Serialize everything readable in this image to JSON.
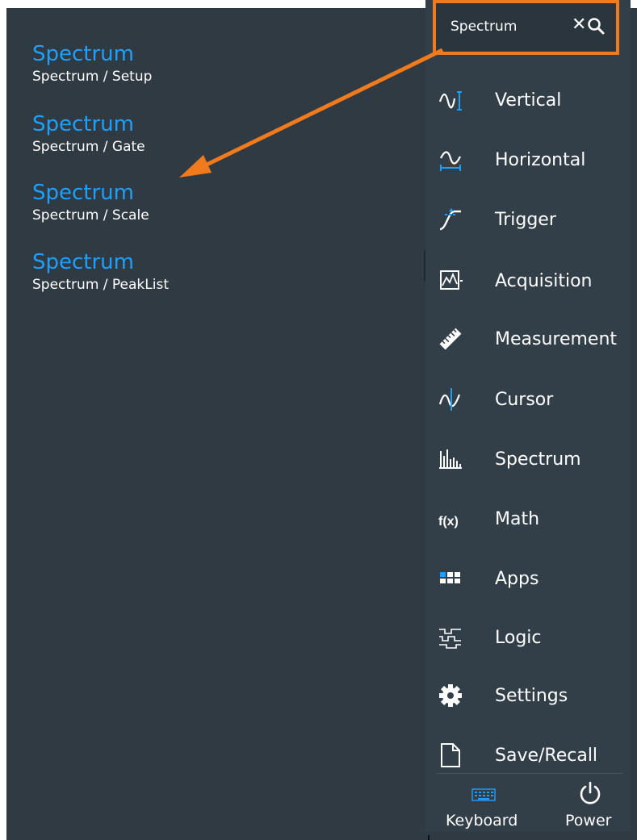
{
  "search": {
    "value": "Spectrum"
  },
  "results": [
    {
      "title": "Spectrum",
      "path": "Spectrum / Setup"
    },
    {
      "title": "Spectrum",
      "path": "Spectrum / Gate"
    },
    {
      "title": "Spectrum",
      "path": "Spectrum / Scale"
    },
    {
      "title": "Spectrum",
      "path": "Spectrum / PeakList"
    }
  ],
  "menu": [
    {
      "label": "Vertical",
      "icon": "vertical-icon"
    },
    {
      "label": "Horizontal",
      "icon": "horizontal-icon"
    },
    {
      "label": "Trigger",
      "icon": "trigger-icon"
    },
    {
      "label": "Acquisition",
      "icon": "acquisition-icon"
    },
    {
      "label": "Measurement",
      "icon": "measurement-icon"
    },
    {
      "label": "Cursor",
      "icon": "cursor-icon"
    },
    {
      "label": "Spectrum",
      "icon": "spectrum-icon"
    },
    {
      "label": "Math",
      "icon": "math-icon"
    },
    {
      "label": "Apps",
      "icon": "apps-icon"
    },
    {
      "label": "Logic",
      "icon": "logic-icon"
    },
    {
      "label": "Settings",
      "icon": "settings-icon"
    },
    {
      "label": "Save/Recall",
      "icon": "save-recall-icon"
    }
  ],
  "bottom": {
    "keyboard": "Keyboard",
    "power": "Power"
  },
  "icon_text": {
    "math": "f(x)"
  },
  "colors": {
    "background": "#2f3a43",
    "accent_blue": "#1ea0ff",
    "highlight_orange": "#f07a1c",
    "text": "#ffffff"
  }
}
